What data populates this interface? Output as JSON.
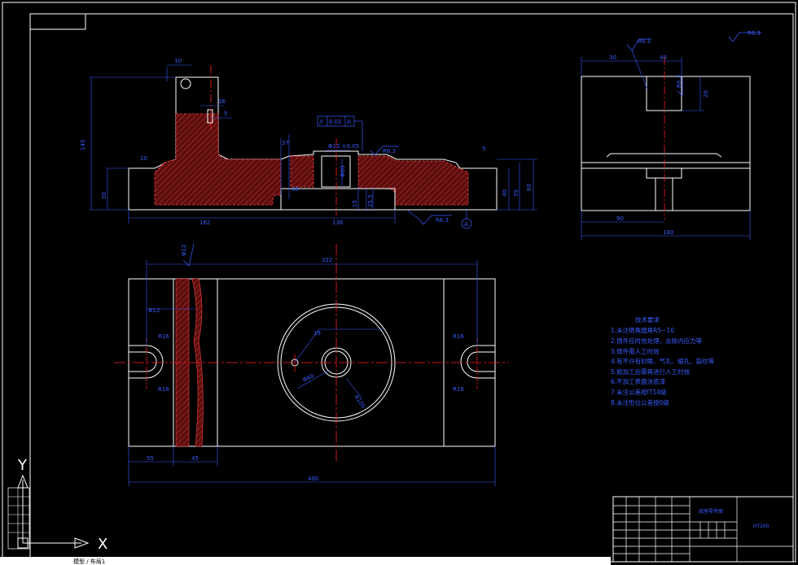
{
  "drawing": {
    "front_view": {
      "dims": {
        "d10": "10",
        "d145": "145",
        "d16": "16",
        "d5": "5",
        "d30": "30",
        "d37": "37",
        "d48": "48",
        "d15": "15",
        "d162": "162",
        "d136": "136",
        "d40": "40",
        "d35": "35",
        "d50": "50",
        "d60": "60",
        "d1": "10",
        "d3": "5",
        "tol": "Φ12 +0.05",
        "ra": "R6.3",
        "ra2": "R6.3",
        "geo1": "//",
        "geo2": "0.02",
        "geo3": "A",
        "datum": "A",
        "d25": "25.5",
        "d6": "Φ60"
      }
    },
    "side_view": {
      "dims": {
        "d30": "30",
        "d40": "40",
        "d90": "90",
        "d180": "180",
        "d20": "20",
        "ra": "R6.3",
        "ra2": "R6.3"
      }
    },
    "plan_view": {
      "dims": {
        "d322": "322",
        "d400": "400",
        "d55": "55",
        "d45": "45",
        "d19": "19",
        "r100": "R100",
        "r16": "R16",
        "r_left": "R16",
        "r_right": "R16",
        "r_right2": "R16",
        "phi60": "Φ60",
        "phi12": "Φ12",
        "phi11": "Φ12"
      }
    },
    "roughness_corner": "R6.3",
    "tech_requirements": {
      "title": "技术要求",
      "items": [
        "1.未注倒角圆角R5~10",
        "2.铸件应时效处理，去除内应力等",
        "3.铸件需人工时效",
        "4.有不许有砂眼、气孔、缩孔、裂纹等",
        "5.粗加工后需再进行人工时效",
        "6.不加工表面涂底漆",
        "7.未注公差按IT14级",
        "8.未注形位公差按0级"
      ]
    },
    "title_block": {
      "part_name": "底座零件图",
      "material": "HT200"
    },
    "ucs": {
      "x_label": "X",
      "y_label": "Y"
    },
    "bottom_text": "模型 / 布局1"
  },
  "colors": {
    "outline": "#ffffff",
    "dimension": "#3a5cff",
    "centerline": "#ff2020",
    "hatch": "#8b1a1a",
    "hatch_border": "#ff4040",
    "frame": "#ffffff"
  }
}
